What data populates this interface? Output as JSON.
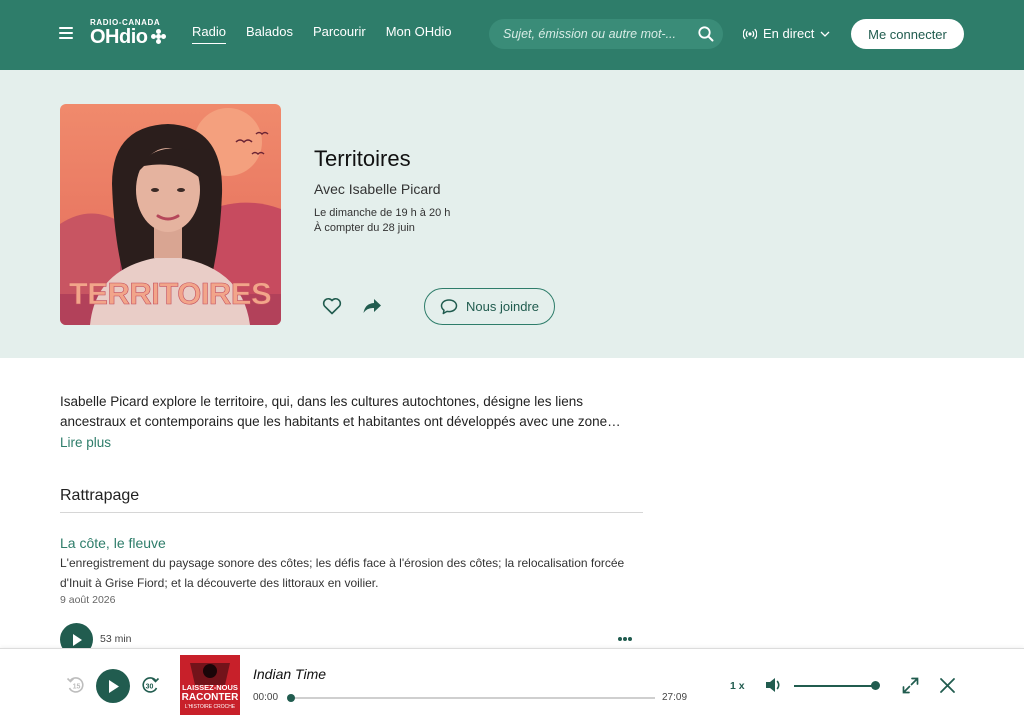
{
  "header": {
    "brand_top": "RADIO-CANADA",
    "brand_main": "OHdio",
    "nav": [
      {
        "label": "Radio",
        "active": true
      },
      {
        "label": "Balados",
        "active": false
      },
      {
        "label": "Parcourir",
        "active": false
      },
      {
        "label": "Mon OHdio",
        "active": false
      }
    ],
    "search_placeholder": "Sujet, émission ou autre mot-...",
    "live_label": "En direct",
    "login_label": "Me connecter"
  },
  "show": {
    "cover_text": "TERRITOIRES",
    "title": "Territoires",
    "host": "Avec Isabelle Picard",
    "schedule": "Le dimanche de 19 h à 20 h",
    "start": "À compter du 28 juin",
    "join_label": "Nous joindre"
  },
  "description": {
    "text": "Isabelle Picard explore le territoire, qui, dans les cultures autochtones, désigne les liens ancestraux et contemporains que les habitants et habitantes ont développés avec une zone…",
    "read_more": "Lire plus"
  },
  "catchup": {
    "heading": "Rattrapage",
    "episodes": [
      {
        "title": "La côte, le fleuve",
        "summary": "L'enregistrement du paysage sonore des côtes; les défis face à l'érosion des côtes; la relocalisation forcée d'Inuit à Grise Fiord; et la découverte des littoraux en voilier.",
        "date": "9 août 2026",
        "duration": "53 min"
      }
    ]
  },
  "player": {
    "title": "Indian Time",
    "thumb_line1": "LAISSEZ-NOUS",
    "thumb_line2": "RACONTER",
    "thumb_line3": "L'HISTOIRE CROCHE",
    "elapsed": "00:00",
    "total": "27:09",
    "progress": 0.0,
    "speed": "1 x",
    "volume": 1.0
  },
  "colors": {
    "brand": "#2e7d6a",
    "brand_dark": "#215c4f",
    "hero_bg": "#e4efec"
  }
}
